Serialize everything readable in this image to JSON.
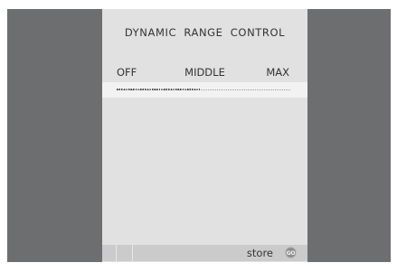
{
  "screen": {
    "title": "DYNAMIC RANGE CONTROL"
  },
  "range_labels": {
    "off": "OFF",
    "middle": "MIDDLE",
    "max": "MAX"
  },
  "slider": {
    "level": 0.48
  },
  "bottom_bar": {
    "store_label": "store",
    "go_button_label": "GO"
  },
  "colors": {
    "frame": "#6d6e70",
    "panel": "#e1e1e2",
    "highlight_row": "#f2f2f3",
    "bottom_bar": "#cbcbcc",
    "text": "#333333"
  }
}
